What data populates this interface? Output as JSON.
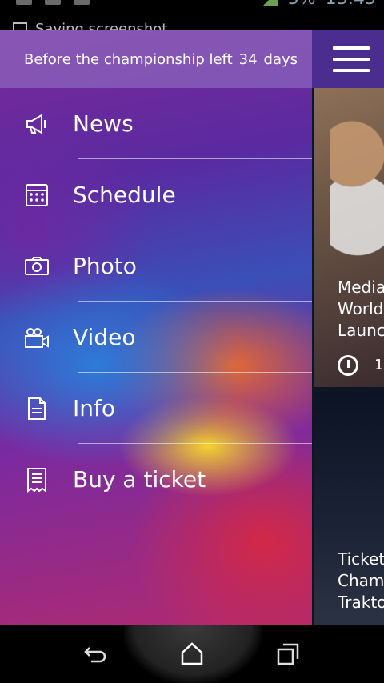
{
  "status_bar": {
    "battery": "5%",
    "time": "13:45",
    "notification": "Saving screenshot"
  },
  "countdown": {
    "prefix": "Before the championship left",
    "days": "34",
    "suffix": "days"
  },
  "menu": [
    {
      "label": "News",
      "icon": "megaphone-icon"
    },
    {
      "label": "Schedule",
      "icon": "calendar-icon"
    },
    {
      "label": "Photo",
      "icon": "camera-icon"
    },
    {
      "label": "Video",
      "icon": "video-camera-icon"
    },
    {
      "label": "Info",
      "icon": "document-icon"
    },
    {
      "label": "Buy a ticket",
      "icon": "receipt-icon"
    }
  ],
  "content": {
    "cards": [
      {
        "title_lines": [
          "Media",
          "World",
          "Launc"
        ],
        "time": "1"
      },
      {
        "title_lines": [
          "Ticket",
          "Cham",
          "Trakto"
        ]
      }
    ]
  },
  "colors": {
    "accent": "#4b2c8f",
    "countdown_bar": "#9678c8"
  }
}
